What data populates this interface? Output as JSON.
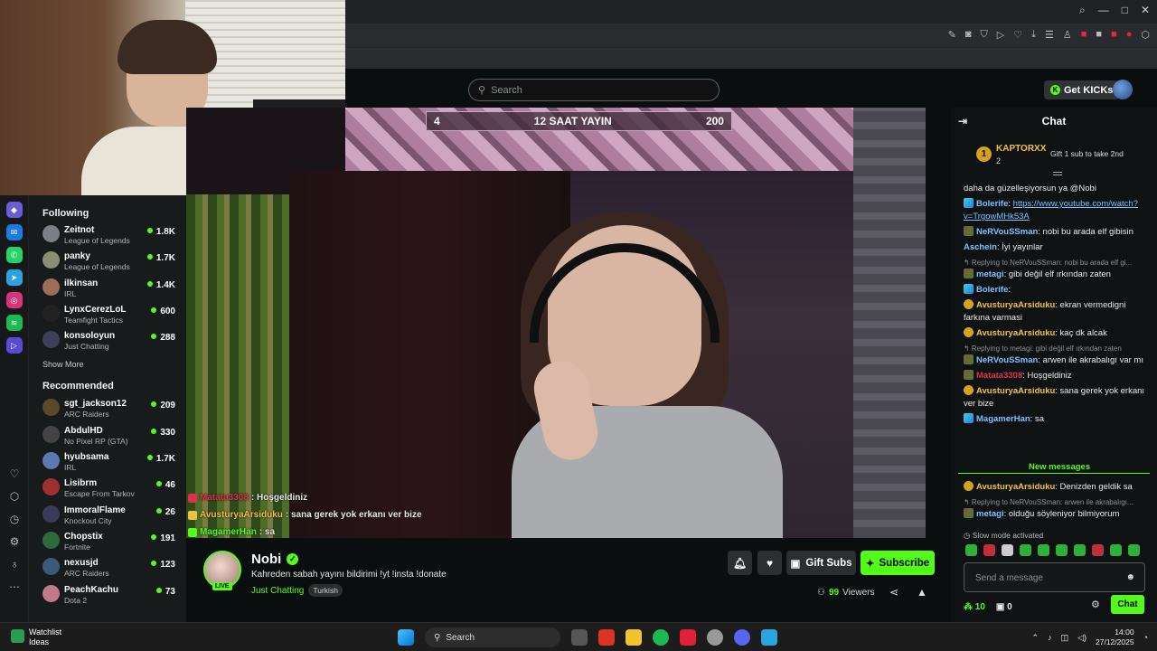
{
  "browser": {
    "window_controls": [
      "⌕",
      "—",
      "□",
      "✕"
    ]
  },
  "topnav": {
    "search_placeholder": "Search",
    "get_kicks_label": "Get KICKs"
  },
  "sidebar": {
    "following_heading": "Following",
    "following": [
      {
        "name": "Zeitnot",
        "category": "League of Legends",
        "viewers": "1.8K",
        "color": "#7b7f86"
      },
      {
        "name": "panky",
        "category": "League of Legends",
        "viewers": "1.7K",
        "color": "#8a8f74"
      },
      {
        "name": "ilkinsan",
        "category": "IRL",
        "viewers": "1.4K",
        "color": "#9c6e56"
      },
      {
        "name": "LynxCerezLoL",
        "category": "Teamfight Tactics",
        "viewers": "600",
        "color": "#222222"
      },
      {
        "name": "konsoloyun",
        "category": "Just Chatting",
        "viewers": "288",
        "color": "#3b3f5a"
      }
    ],
    "show_more": "Show More",
    "recommended_heading": "Recommended",
    "recommended": [
      {
        "name": "sgt_jackson12",
        "category": "ARC Raiders",
        "viewers": "209",
        "color": "#5a4a2a"
      },
      {
        "name": "AbdulHD",
        "category": "No Pixel RP (GTA)",
        "viewers": "330",
        "color": "#444444"
      },
      {
        "name": "hyubsama",
        "category": "IRL",
        "viewers": "1.7K",
        "color": "#5a7ab0"
      },
      {
        "name": "Lisibrm",
        "category": "Escape From Tarkov",
        "viewers": "46",
        "color": "#a03030"
      },
      {
        "name": "ImmoralFlame",
        "category": "Knockout City",
        "viewers": "26",
        "color": "#3a3a5a"
      },
      {
        "name": "Chopstix",
        "category": "Fortnite",
        "viewers": "191",
        "color": "#2d6b3a"
      },
      {
        "name": "nexusjd",
        "category": "ARC Raiders",
        "viewers": "123",
        "color": "#3a5a7a"
      },
      {
        "name": "PeachKachu",
        "category": "Dota 2",
        "viewers": "73",
        "color": "#c07a8a"
      }
    ]
  },
  "video": {
    "overlay_left": "4",
    "overlay_title": "12 SAAT YAYIN",
    "overlay_right": "200",
    "chat_overlay": [
      {
        "user": "Matata3308",
        "text": ": Hoşgeldiniz",
        "color": "#e0304a"
      },
      {
        "user": "AvusturyaArsiduku",
        "text": ": sana gerek yok erkanı ver bize",
        "color": "#f0c040"
      },
      {
        "user": "MagamerHan",
        "text": ": sa",
        "color": "#53fc18"
      }
    ]
  },
  "stream": {
    "channel_name": "Nobi",
    "live_label": "LIVE",
    "title": "Kahreden sabah yayını bildirimi   !yt !insta !donate",
    "category": "Just Chatting",
    "tag": "Turkish",
    "gift_subs_label": "Gift Subs",
    "subscribe_label": "Subscribe",
    "viewers_count": "99",
    "viewers_label": "Viewers"
  },
  "chat": {
    "header": "Chat",
    "pinned": {
      "rank": "1",
      "user": "KAPTORXX",
      "count": "2",
      "gift_note": "Gift 1 sub to take 2nd"
    },
    "messages": [
      {
        "type": "text",
        "text": "daha da güzelleşiyorsun ya @Nobi"
      },
      {
        "type": "msg",
        "badge": "blue",
        "user": "Bolerife",
        "color": "#7ec0ff",
        "text": ": ",
        "link": "https://www.youtube.com/watch?v=TrgowMHk53A"
      },
      {
        "type": "msg",
        "badge": "mc",
        "user": "NeRVouSSman",
        "color": "#7ec0ff",
        "text": ": nobi bu arada elf gibisin"
      },
      {
        "type": "msg",
        "badge": "",
        "user": "Aschein",
        "color": "#7ec0ff",
        "text": ": İyi yayınlar"
      },
      {
        "type": "reply",
        "text": "↰ Replying to NeRVouSSman: nobi bu arada elf gi..."
      },
      {
        "type": "msg",
        "badge": "mc",
        "user": "metagi",
        "color": "#7ec0ff",
        "text": ": gibi değil elf ırkından zaten"
      },
      {
        "type": "msg",
        "badge": "blue",
        "user": "Bolerife",
        "color": "#7ec0ff",
        "text": ": "
      },
      {
        "type": "msg",
        "badge": "gold",
        "user": "AvusturyaArsiduku",
        "color": "#f0c040",
        "text": ": ekran vermedigni farkına varmasi"
      },
      {
        "type": "msg",
        "badge": "gold",
        "user": "AvusturyaArsiduku",
        "color": "#f0c040",
        "text": ": kaç dk alcak"
      },
      {
        "type": "reply",
        "text": "↰ Replying to metagi: gibi değil elf ırkından zaten"
      },
      {
        "type": "msg",
        "badge": "mc",
        "user": "NeRVouSSman",
        "color": "#7ec0ff",
        "text": ": arwen ile akrabalıgı var mı"
      },
      {
        "type": "msg",
        "badge": "mc",
        "user": "Matata3308",
        "color": "#e0304a",
        "text": ": Hoşgeldiniz"
      },
      {
        "type": "msg",
        "badge": "gold",
        "user": "AvusturyaArsiduku",
        "color": "#f0c040",
        "text": ": sana gerek yok erkanı ver bize"
      },
      {
        "type": "msg",
        "badge": "blue",
        "user": "MagamerHan",
        "color": "#7ec0ff",
        "text": ": sa"
      }
    ],
    "new_messages_label": "New messages",
    "new_messages": [
      {
        "type": "msg",
        "badge": "gold",
        "user": "AvusturyaArsiduku",
        "color": "#f0c040",
        "text": ": Denizden geldik sa"
      },
      {
        "type": "reply",
        "text": "↰ Replying to NeRVouSSman: arwen ile akrabalıgı..."
      },
      {
        "type": "msg",
        "badge": "mc",
        "user": "metagi",
        "color": "#7ec0ff",
        "text": ": olduğu söyleniyor bilmiyorum"
      }
    ],
    "slow_mode": "Slow mode activated",
    "input_placeholder": "Send a message",
    "points": "10",
    "gifts": "0",
    "send_label": "Chat"
  },
  "taskbar": {
    "widget_title": "Watchlist",
    "widget_sub": "Ideas",
    "search_label": "Search",
    "time": "14:00",
    "date": "27/12/2025"
  }
}
